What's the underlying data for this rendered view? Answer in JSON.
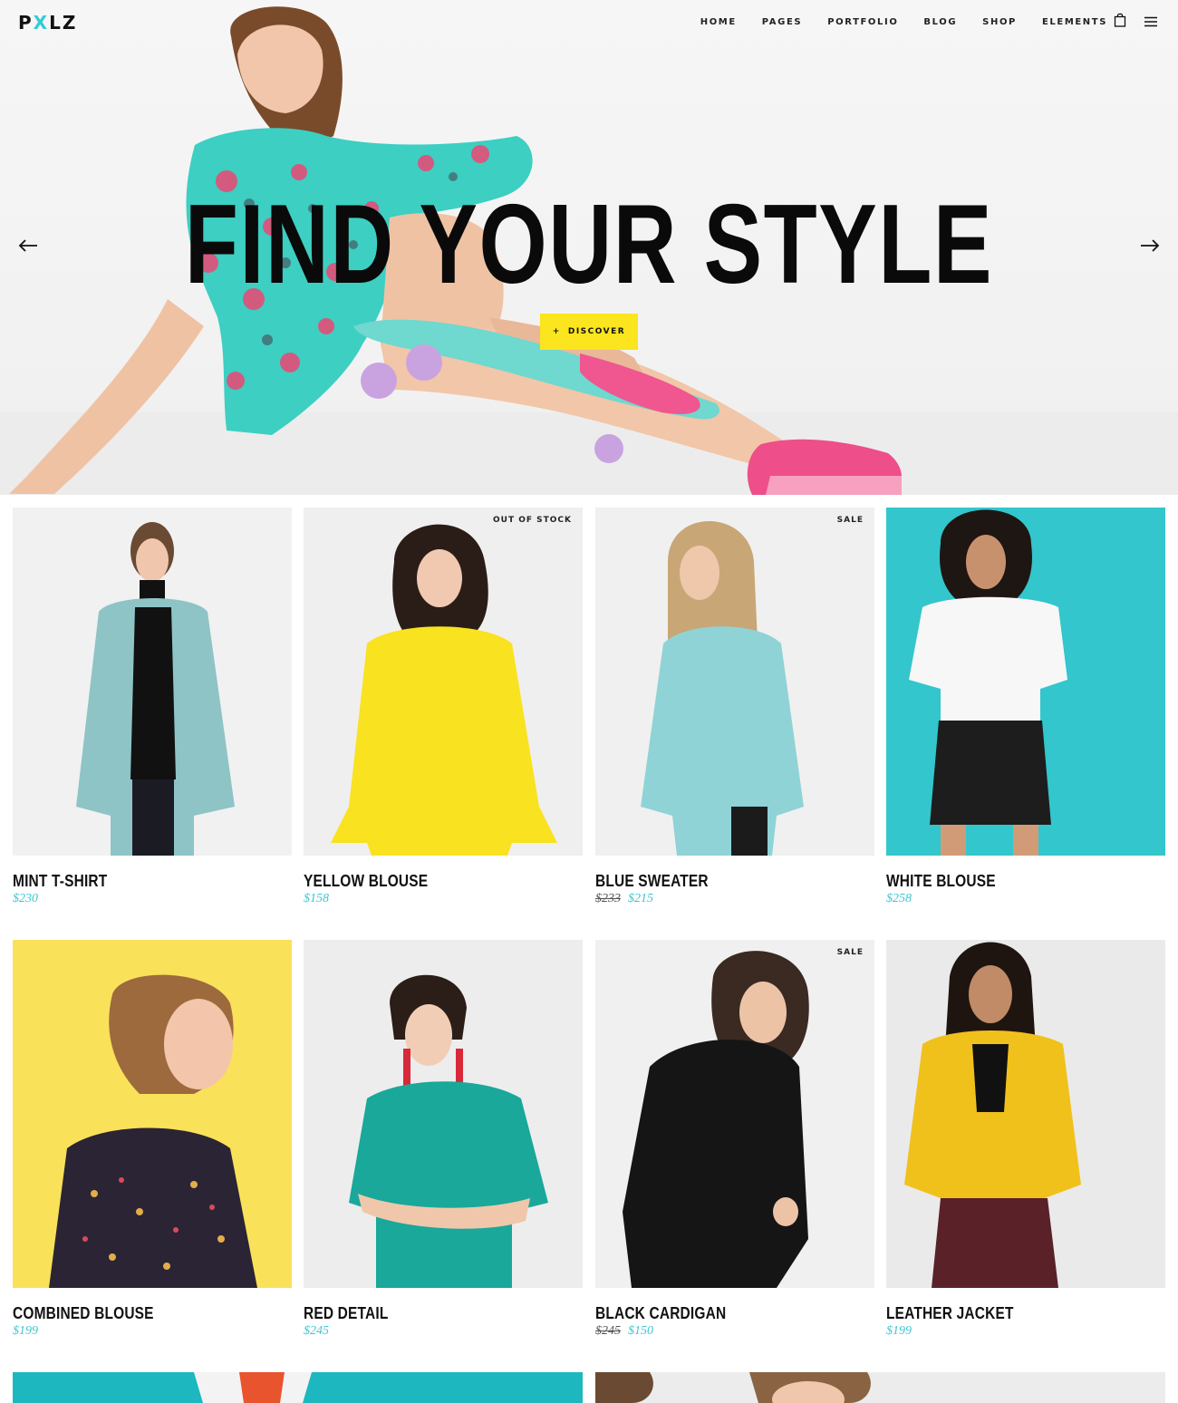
{
  "brand": {
    "logo_prefix": "P",
    "logo_accent": "X",
    "logo_suffix": "LZ",
    "accent_color": "#33ccd6"
  },
  "nav": {
    "items": [
      "HOME",
      "PAGES",
      "PORTFOLIO",
      "BLOG",
      "SHOP",
      "ELEMENTS"
    ]
  },
  "icons": {
    "cart": "shopping-bag-icon",
    "menu": "hamburger-menu-icon",
    "prev": "arrow-left-icon",
    "next": "arrow-right-icon"
  },
  "hero": {
    "title": "FIND YOUR STYLE",
    "button_icon": "+",
    "button_label": "DISCOVER",
    "button_color": "#fae51e"
  },
  "products": [
    {
      "name": "MINT T-SHIRT",
      "price": "$230",
      "old_price": "",
      "badge": ""
    },
    {
      "name": "YELLOW BLOUSE",
      "price": "$158",
      "old_price": "",
      "badge": "OUT OF STOCK"
    },
    {
      "name": "BLUE SWEATER",
      "price": "$215",
      "old_price": "$233",
      "badge": "SALE"
    },
    {
      "name": "WHITE BLOUSE",
      "price": "$258",
      "old_price": "",
      "badge": ""
    },
    {
      "name": "COMBINED BLOUSE",
      "price": "$199",
      "old_price": "",
      "badge": ""
    },
    {
      "name": "RED DETAIL",
      "price": "$245",
      "old_price": "",
      "badge": ""
    },
    {
      "name": "BLACK CARDIGAN",
      "price": "$150",
      "old_price": "$245",
      "badge": "SALE"
    },
    {
      "name": "LEATHER JACKET",
      "price": "$199",
      "old_price": "",
      "badge": ""
    }
  ],
  "price_color": "#3dc6d0"
}
